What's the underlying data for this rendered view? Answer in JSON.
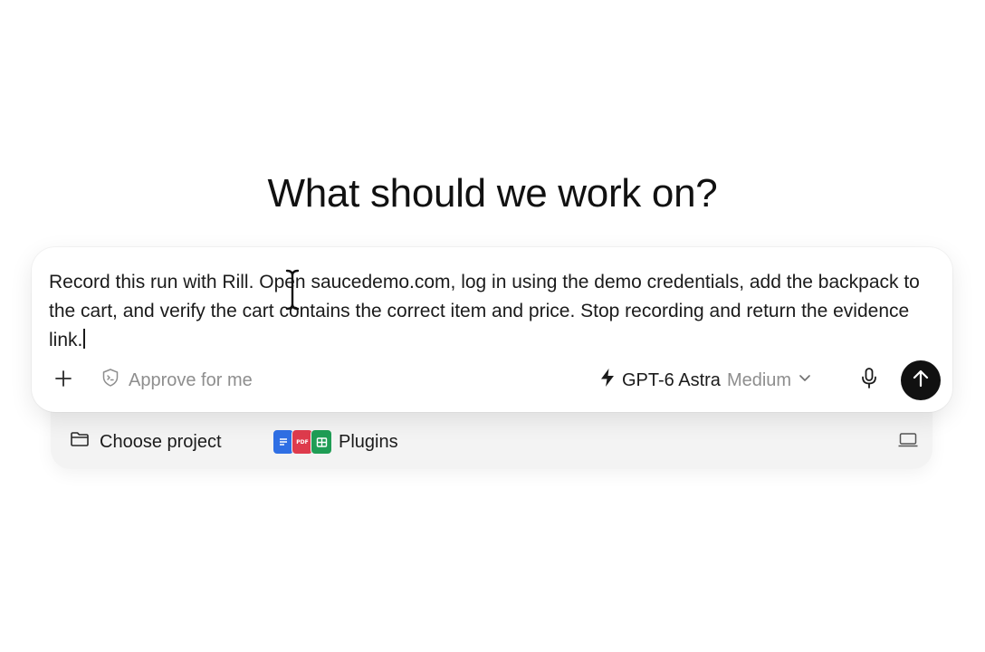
{
  "heading": "What should we work on?",
  "composer": {
    "prompt": "Record this run with Rill. Open saucedemo.com, log in using the demo credentials, add the backpack to the cart, and verify the cart contains the correct item and price. Stop recording and return the evidence link.",
    "approve_label": "Approve for me",
    "model": {
      "name": "GPT-6 Astra",
      "effort": "Medium"
    }
  },
  "tray": {
    "project_label": "Choose project",
    "plugins_label": "Plugins",
    "plugin_icons": [
      "docs-icon",
      "pdf-icon",
      "sheets-icon"
    ]
  },
  "icons": {
    "add": "plus-icon",
    "approve": "shield-icon",
    "model": "lightning-icon",
    "model_dropdown": "chevron-down-icon",
    "voice": "microphone-icon",
    "send": "arrow-up-icon",
    "project": "folder-icon",
    "device": "laptop-icon"
  },
  "colors": {
    "send_button": "#111111",
    "muted_text": "#8e8e8e",
    "tray_background": "#f3f3f3",
    "docs": "#2f6fe4",
    "pdf": "#de3b4c",
    "sheets": "#1f9d55"
  }
}
